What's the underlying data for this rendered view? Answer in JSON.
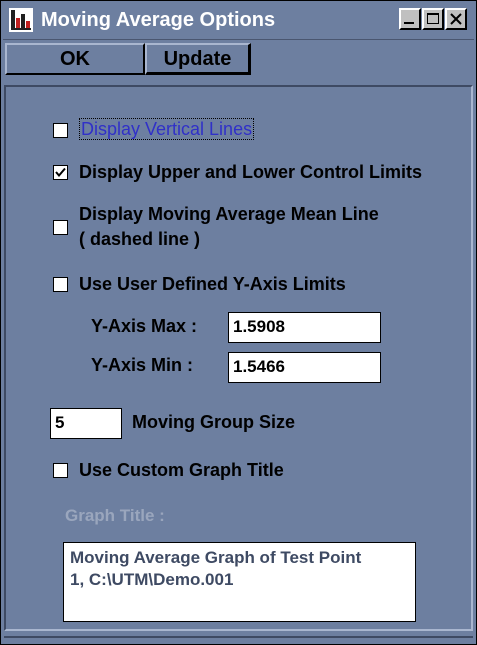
{
  "window": {
    "title": "Moving Average Options",
    "icons": {
      "app": "chart-app-icon",
      "minimize": "minimize-icon",
      "maximize": "maximize-icon",
      "close": "close-icon"
    }
  },
  "toolbar": {
    "ok_label": "OK",
    "update_label": "Update"
  },
  "options": {
    "vertical_lines": {
      "label": "Display Vertical Lines",
      "checked": false
    },
    "control_limits": {
      "label": "Display Upper and Lower Control Limits",
      "checked": true
    },
    "mean_line": {
      "label_line1": "Display Moving Average Mean Line",
      "label_line2": "( dashed line )",
      "checked": false
    },
    "user_y_limits": {
      "label": "Use User Defined Y-Axis Limits",
      "checked": false
    },
    "custom_title": {
      "label": "Use Custom Graph Title",
      "checked": false
    }
  },
  "y_axis": {
    "max_label": "Y-Axis Max :",
    "max_value": "1.5908",
    "min_label": "Y-Axis Min :",
    "min_value": "1.5466"
  },
  "group": {
    "size_value": "5",
    "size_label": "Moving Group Size"
  },
  "graph_title": {
    "label": "Graph Title :",
    "value": "Moving Average Graph of Test Point\n1, C:\\UTM\\Demo.001"
  },
  "colors": {
    "window_bg": "#6d7fa0",
    "link_text": "#3030c8",
    "disabled_text": "#9aa6bd"
  }
}
